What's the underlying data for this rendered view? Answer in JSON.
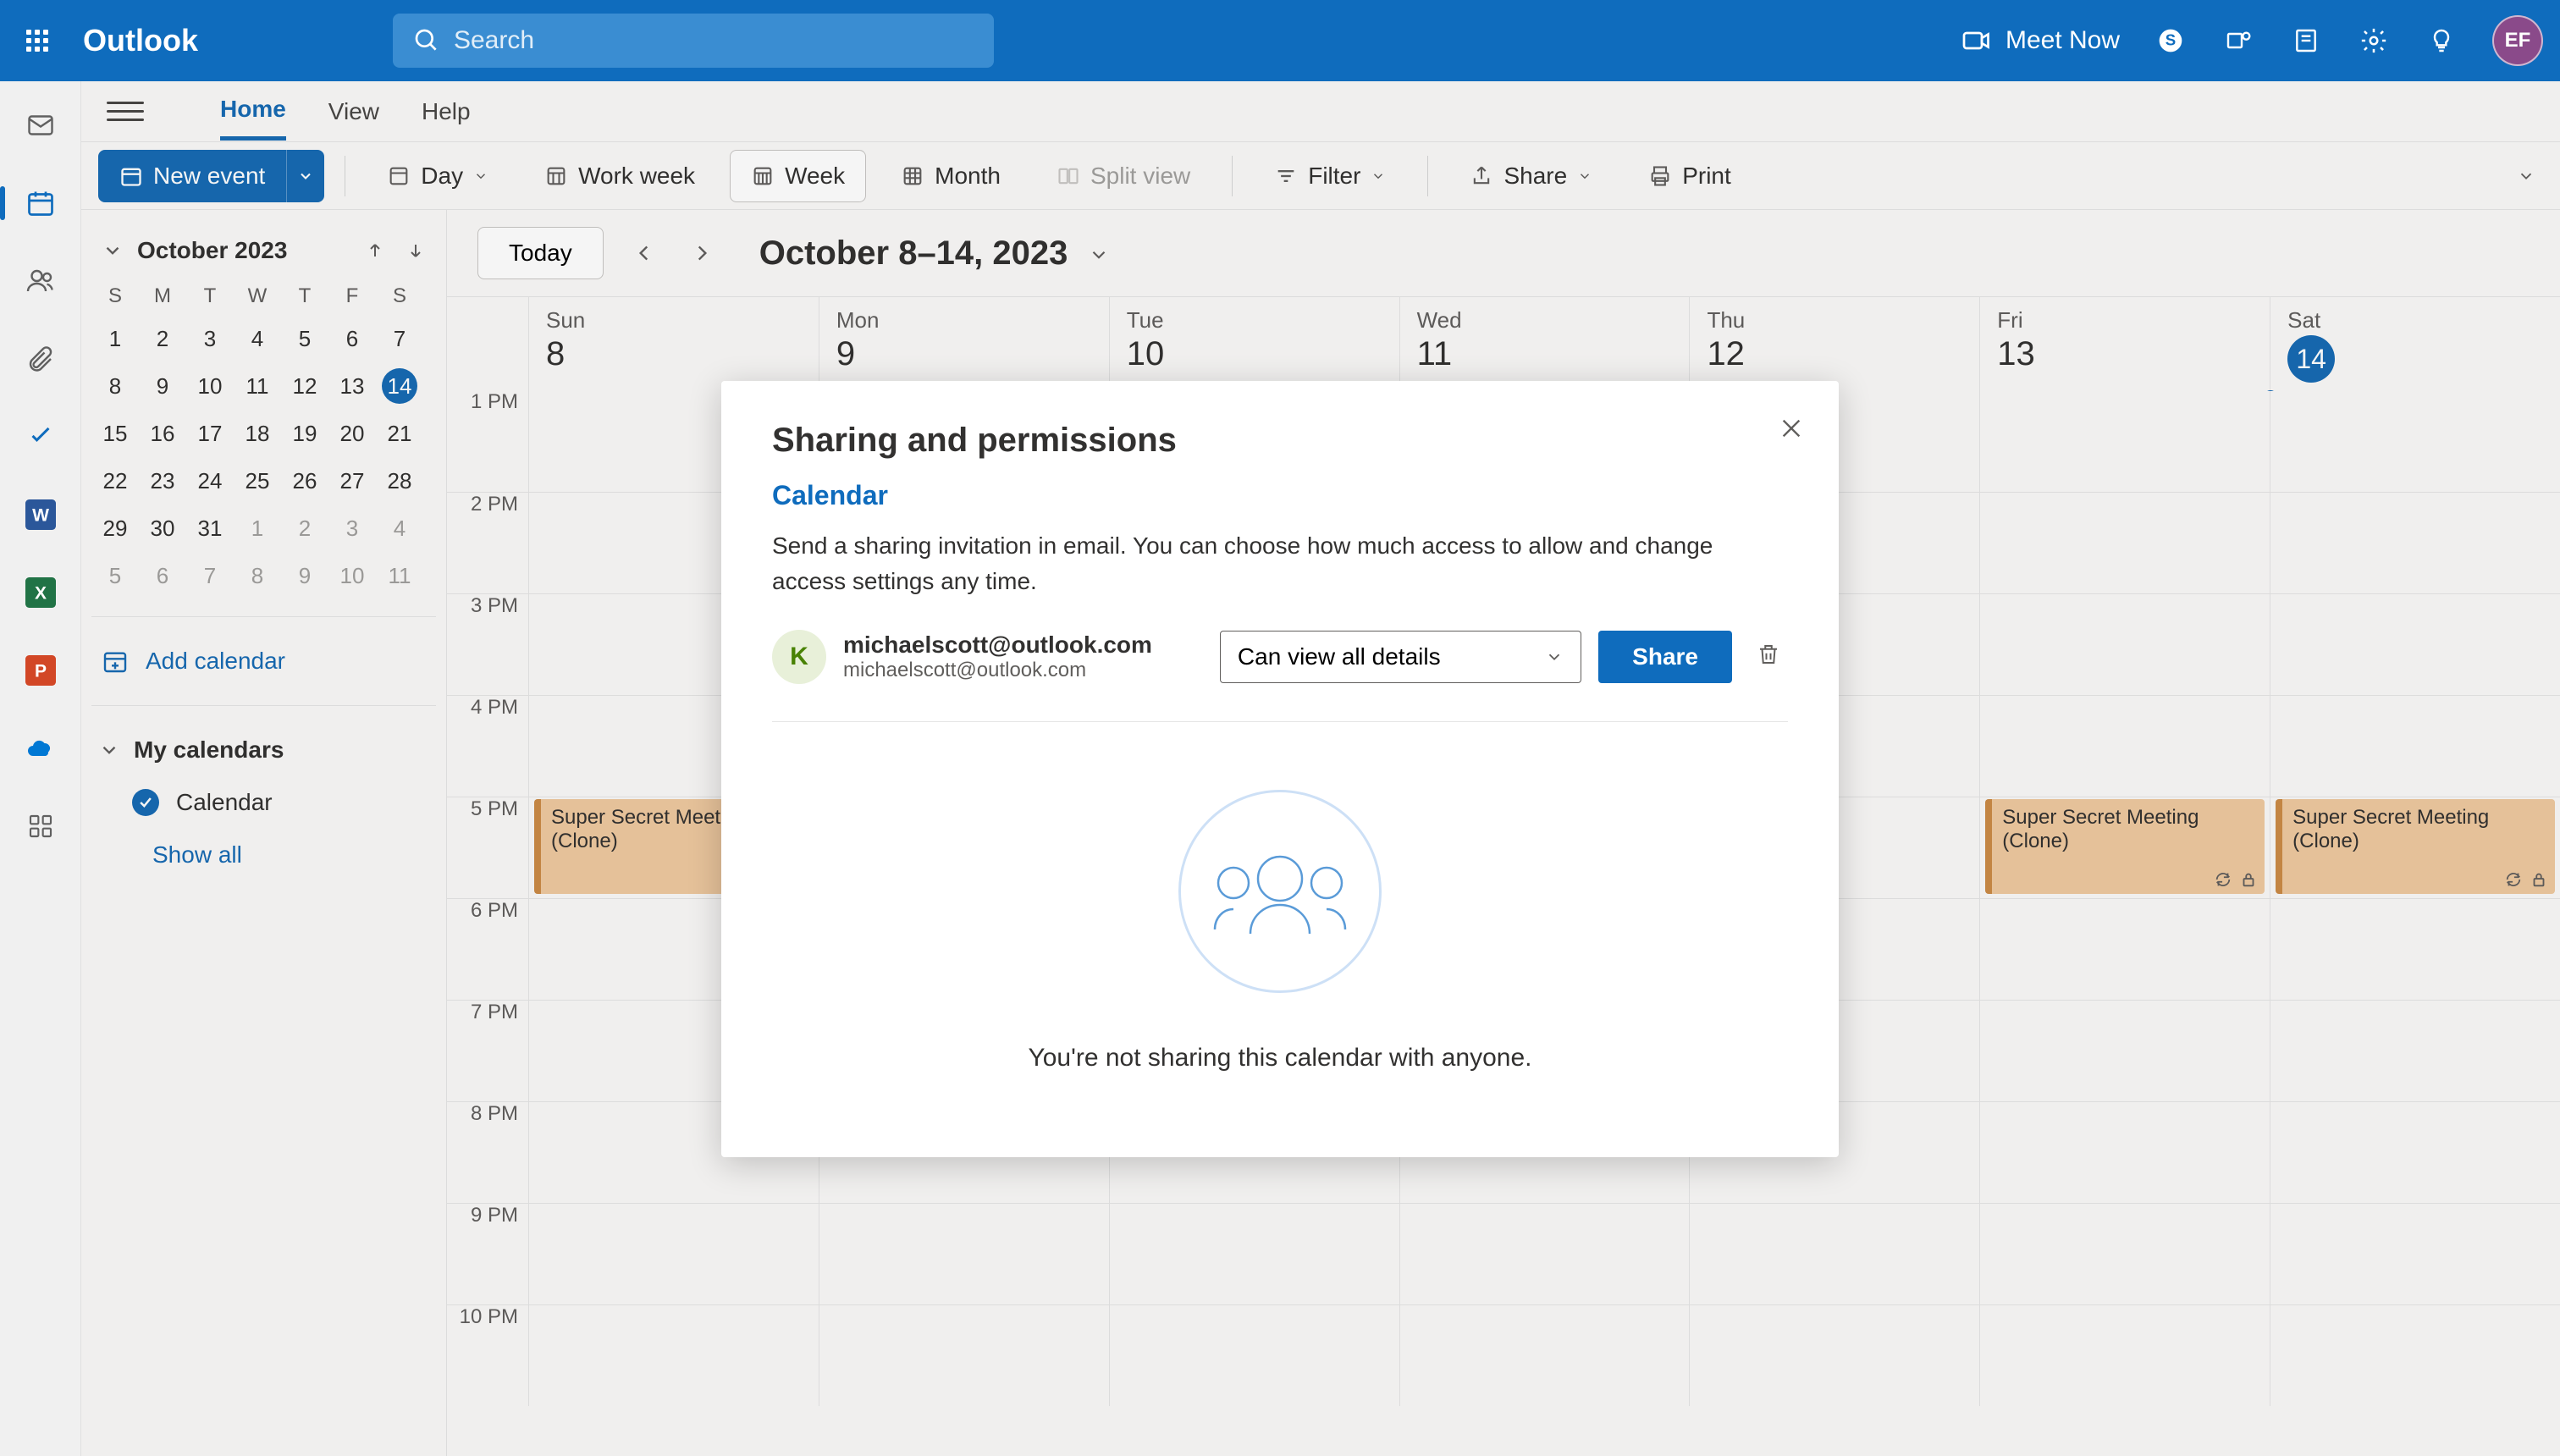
{
  "header": {
    "app_name": "Outlook",
    "search_placeholder": "Search",
    "meet_now": "Meet Now",
    "avatar_initials": "EF"
  },
  "ribbon": {
    "tabs": [
      "Home",
      "View",
      "Help"
    ],
    "active_tab": 0
  },
  "toolbar": {
    "new_event": "New event",
    "day": "Day",
    "work_week": "Work week",
    "week": "Week",
    "month": "Month",
    "split_view": "Split view",
    "filter": "Filter",
    "share": "Share",
    "print": "Print"
  },
  "sidebar": {
    "month_label": "October 2023",
    "day_labels": [
      "S",
      "M",
      "T",
      "W",
      "T",
      "F",
      "S"
    ],
    "weeks": [
      [
        {
          "n": "1",
          "m": false
        },
        {
          "n": "2",
          "m": false
        },
        {
          "n": "3",
          "m": false
        },
        {
          "n": "4",
          "m": false
        },
        {
          "n": "5",
          "m": false
        },
        {
          "n": "6",
          "m": false
        },
        {
          "n": "7",
          "m": false
        }
      ],
      [
        {
          "n": "8",
          "m": false
        },
        {
          "n": "9",
          "m": false
        },
        {
          "n": "10",
          "m": false
        },
        {
          "n": "11",
          "m": false
        },
        {
          "n": "12",
          "m": false
        },
        {
          "n": "13",
          "m": false
        },
        {
          "n": "14",
          "m": false,
          "today": true
        }
      ],
      [
        {
          "n": "15",
          "m": false
        },
        {
          "n": "16",
          "m": false
        },
        {
          "n": "17",
          "m": false
        },
        {
          "n": "18",
          "m": false
        },
        {
          "n": "19",
          "m": false
        },
        {
          "n": "20",
          "m": false
        },
        {
          "n": "21",
          "m": false
        }
      ],
      [
        {
          "n": "22",
          "m": false
        },
        {
          "n": "23",
          "m": false
        },
        {
          "n": "24",
          "m": false
        },
        {
          "n": "25",
          "m": false
        },
        {
          "n": "26",
          "m": false
        },
        {
          "n": "27",
          "m": false
        },
        {
          "n": "28",
          "m": false
        }
      ],
      [
        {
          "n": "29",
          "m": false
        },
        {
          "n": "30",
          "m": false
        },
        {
          "n": "31",
          "m": false
        },
        {
          "n": "1",
          "m": true
        },
        {
          "n": "2",
          "m": true
        },
        {
          "n": "3",
          "m": true
        },
        {
          "n": "4",
          "m": true
        }
      ],
      [
        {
          "n": "5",
          "m": true
        },
        {
          "n": "6",
          "m": true
        },
        {
          "n": "7",
          "m": true
        },
        {
          "n": "8",
          "m": true
        },
        {
          "n": "9",
          "m": true
        },
        {
          "n": "10",
          "m": true
        },
        {
          "n": "11",
          "m": true
        }
      ]
    ],
    "add_calendar": "Add calendar",
    "my_calendars": "My calendars",
    "calendar_name": "Calendar",
    "show_all": "Show all"
  },
  "cal": {
    "today": "Today",
    "range": "October 8–14, 2023",
    "days": [
      {
        "label": "Sun",
        "num": "8"
      },
      {
        "label": "Mon",
        "num": "9"
      },
      {
        "label": "Tue",
        "num": "10"
      },
      {
        "label": "Wed",
        "num": "11"
      },
      {
        "label": "Thu",
        "num": "12"
      },
      {
        "label": "Fri",
        "num": "13"
      },
      {
        "label": "Sat",
        "num": "14",
        "today": true
      }
    ],
    "hours": [
      "1 PM",
      "2 PM",
      "3 PM",
      "4 PM",
      "5 PM",
      "6 PM",
      "7 PM",
      "8 PM",
      "9 PM",
      "10 PM"
    ],
    "events": {
      "sun": {
        "title": "Super Secret Meeting (Clone)"
      },
      "fri": {
        "title": "Super Secret Meeting (Clone)"
      },
      "sat": {
        "title": "Super Secret Meeting (Clone)"
      }
    }
  },
  "modal": {
    "title": "Sharing and permissions",
    "subtitle": "Calendar",
    "description": "Send a sharing invitation in email. You can choose how much access to allow and change access settings any time.",
    "user_initial": "K",
    "user_email_display": "michaelscott@outlook.com",
    "user_email_sub": "michaelscott@outlook.com",
    "permission_selected": "Can view all details",
    "share_button": "Share",
    "empty_text": "You're not sharing this calendar with anyone."
  }
}
